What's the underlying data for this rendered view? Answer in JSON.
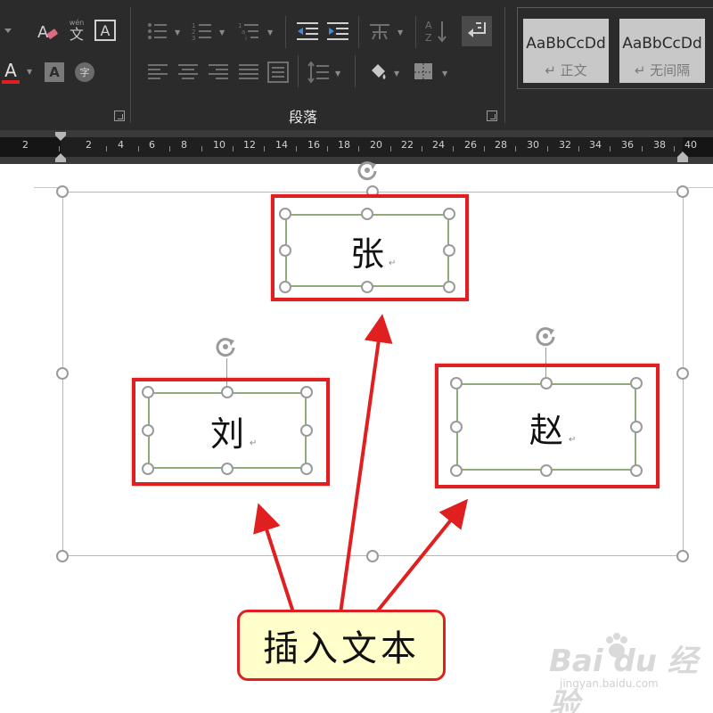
{
  "ribbon": {
    "paragraph_group_label": "段落",
    "styles": [
      {
        "preview": "AaBbCcDd",
        "name": "↵ 正文"
      },
      {
        "preview": "AaBbCcDd",
        "name": "↵ 无间隔"
      }
    ],
    "phonetic_label": "wén",
    "phonetic_char": "文",
    "enclose_char": "字",
    "font_color": "#e02020"
  },
  "ruler": {
    "ticks": [
      "2",
      "2",
      "4",
      "6",
      "8",
      "10",
      "12",
      "14",
      "16",
      "18",
      "20",
      "22",
      "24",
      "26",
      "28",
      "30",
      "32",
      "34",
      "36",
      "38",
      "40"
    ]
  },
  "document": {
    "textboxes": [
      {
        "text": "张"
      },
      {
        "text": "刘"
      },
      {
        "text": "赵"
      }
    ],
    "callout_text": "插入文本",
    "highlight_color": "#e02020"
  },
  "watermark": {
    "brand": "Bai du 经验",
    "url": "jingyan.baidu.com"
  }
}
